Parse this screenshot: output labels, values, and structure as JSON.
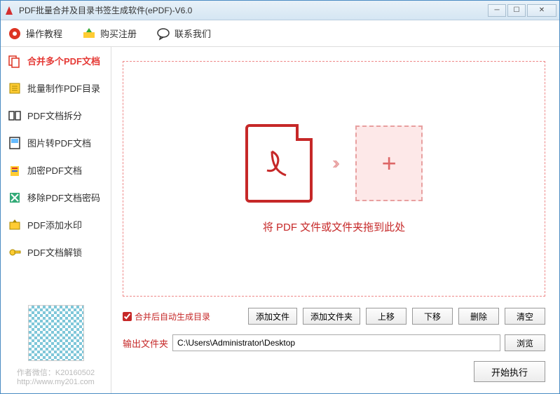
{
  "window": {
    "title": "PDF批量合并及目录书签生成软件(ePDF)-V6.0"
  },
  "toolbar": {
    "tutorial": "操作教程",
    "purchase": "购买注册",
    "contact": "联系我们"
  },
  "sidebar": {
    "items": [
      {
        "label": "合并多个PDF文档"
      },
      {
        "label": "批量制作PDF目录"
      },
      {
        "label": "PDF文档拆分"
      },
      {
        "label": "图片转PDF文档"
      },
      {
        "label": "加密PDF文档"
      },
      {
        "label": "移除PDF文档密码"
      },
      {
        "label": "PDF添加水印"
      },
      {
        "label": "PDF文档解锁"
      }
    ],
    "footer": {
      "wechat": "作者微信：K20160502",
      "website": "http://www.my201.com"
    }
  },
  "content": {
    "drop_text": "将 PDF 文件或文件夹拖到此处",
    "checkbox_label": "合并后自动生成目录",
    "buttons": {
      "add_file": "添加文件",
      "add_folder": "添加文件夹",
      "move_up": "上移",
      "move_down": "下移",
      "delete": "删除",
      "clear": "清空"
    },
    "output": {
      "label": "输出文件夹",
      "value": "C:\\Users\\Administrator\\Desktop",
      "browse": "浏览"
    },
    "execute": "开始执行"
  }
}
